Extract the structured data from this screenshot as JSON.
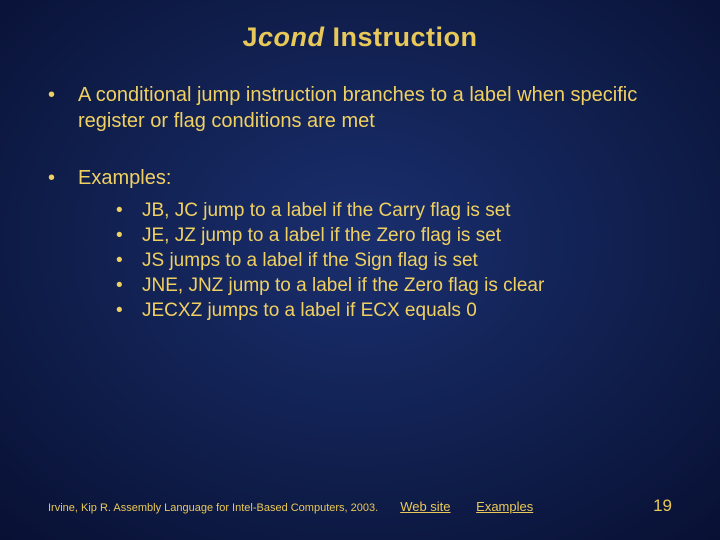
{
  "title": {
    "j": "J",
    "cond": "cond",
    "rest": " Instruction"
  },
  "bullets": [
    "A conditional jump instruction branches to a label when specific register or flag conditions are met",
    "Examples:"
  ],
  "sub": [
    "JB, JC jump to a label if the Carry flag is set",
    "JE, JZ jump to a label if the Zero flag is set",
    "JS jumps to a label if the Sign flag is set",
    "JNE, JNZ jump to a label if the Zero flag is clear",
    "JECXZ jumps to a label if ECX equals 0"
  ],
  "footer": {
    "cite": "Irvine, Kip R. Assembly Language for Intel-Based Computers, 2003.",
    "link1": "Web site",
    "link2": "Examples",
    "page": "19"
  }
}
